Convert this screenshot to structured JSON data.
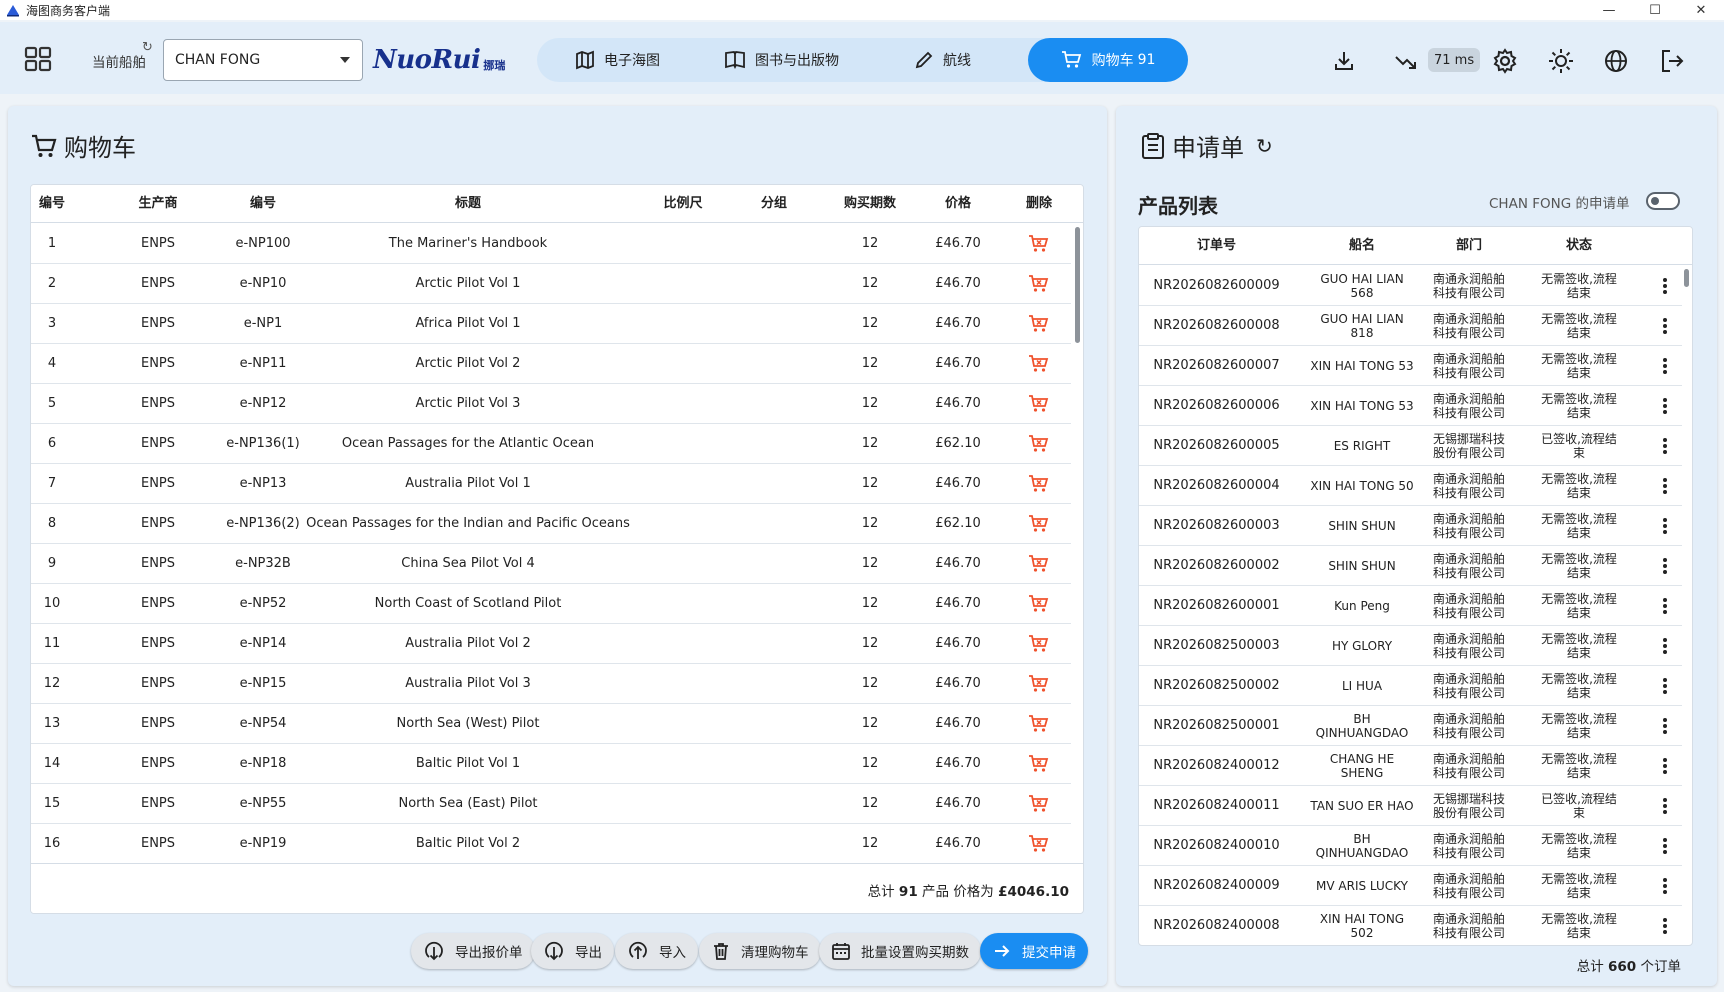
{
  "window": {
    "title": "海图商务客户端",
    "controls": [
      "—",
      "☐",
      "✕"
    ]
  },
  "toolbar": {
    "current_ship_label": "当前船舶",
    "ship": "CHAN FONG",
    "brand": "NuoRui",
    "brand_cn": "挪瑞",
    "tabs": [
      {
        "label": "电子海图",
        "icon": "map-icon"
      },
      {
        "label": "图书与出版物",
        "icon": "book-icon"
      },
      {
        "label": "航线",
        "icon": "pencil-icon"
      },
      {
        "label": "购物车",
        "count": "91",
        "icon": "cart-icon",
        "active": true
      }
    ],
    "latency": "71 ms",
    "accent_color": "#1a8df2"
  },
  "cart": {
    "title": "购物车",
    "columns": [
      "编号",
      "生产商",
      "编号",
      "标题",
      "比例尺",
      "分组",
      "购买期数",
      "价格",
      "删除"
    ],
    "rows": [
      [
        "1",
        "ENPS",
        "e-NP100",
        "The Mariner's Handbook",
        "",
        "",
        "12",
        "£46.70"
      ],
      [
        "2",
        "ENPS",
        "e-NP10",
        "Arctic Pilot Vol 1",
        "",
        "",
        "12",
        "£46.70"
      ],
      [
        "3",
        "ENPS",
        "e-NP1",
        "Africa Pilot Vol 1",
        "",
        "",
        "12",
        "£46.70"
      ],
      [
        "4",
        "ENPS",
        "e-NP11",
        "Arctic Pilot Vol 2",
        "",
        "",
        "12",
        "£46.70"
      ],
      [
        "5",
        "ENPS",
        "e-NP12",
        "Arctic Pilot Vol 3",
        "",
        "",
        "12",
        "£46.70"
      ],
      [
        "6",
        "ENPS",
        "e-NP136(1)",
        "Ocean Passages for the Atlantic Ocean",
        "",
        "",
        "12",
        "£62.10"
      ],
      [
        "7",
        "ENPS",
        "e-NP13",
        "Australia Pilot Vol 1",
        "",
        "",
        "12",
        "£46.70"
      ],
      [
        "8",
        "ENPS",
        "e-NP136(2)",
        "Ocean Passages for the Indian and Pacific Oceans",
        "",
        "",
        "12",
        "£62.10"
      ],
      [
        "9",
        "ENPS",
        "e-NP32B",
        "China Sea Pilot Vol 4",
        "",
        "",
        "12",
        "£46.70"
      ],
      [
        "10",
        "ENPS",
        "e-NP52",
        "North Coast of Scotland Pilot",
        "",
        "",
        "12",
        "£46.70"
      ],
      [
        "11",
        "ENPS",
        "e-NP14",
        "Australia Pilot Vol 2",
        "",
        "",
        "12",
        "£46.70"
      ],
      [
        "12",
        "ENPS",
        "e-NP15",
        "Australia Pilot Vol 3",
        "",
        "",
        "12",
        "£46.70"
      ],
      [
        "13",
        "ENPS",
        "e-NP54",
        "North Sea (West) Pilot",
        "",
        "",
        "12",
        "£46.70"
      ],
      [
        "14",
        "ENPS",
        "e-NP18",
        "Baltic Pilot Vol 1",
        "",
        "",
        "12",
        "£46.70"
      ],
      [
        "15",
        "ENPS",
        "e-NP55",
        "North Sea (East) Pilot",
        "",
        "",
        "12",
        "£46.70"
      ],
      [
        "16",
        "ENPS",
        "e-NP19",
        "Baltic Pilot Vol 2",
        "",
        "",
        "12",
        "£46.70"
      ]
    ],
    "footer": {
      "prefix": "总计",
      "count": "91",
      "mid": "产品 价格为",
      "total": "£4046.10"
    },
    "delete_icon_color": "#f0522c",
    "buttons": [
      {
        "label": "导出报价单",
        "icon": "download-circle-icon"
      },
      {
        "label": "导出",
        "icon": "download-circle-icon"
      },
      {
        "label": "导入",
        "icon": "upload-circle-icon"
      },
      {
        "label": "清理购物车",
        "icon": "trash-icon"
      },
      {
        "label": "批量设置购买期数",
        "icon": "calendar-icon"
      },
      {
        "label": "提交申请",
        "icon": "arrow-right-icon"
      }
    ]
  },
  "requests": {
    "title": "申请单",
    "subtitle": "产品列表",
    "toggle_label": "CHAN FONG 的申请单",
    "columns": [
      "订单号",
      "船名",
      "部门",
      "状态"
    ],
    "rows": [
      [
        "NR2026082600009",
        "GUO HAI LIAN 568",
        "南通永润船舶科技有限公司",
        "无需签收,流程结束"
      ],
      [
        "NR2026082600008",
        "GUO HAI LIAN 818",
        "南通永润船舶科技有限公司",
        "无需签收,流程结束"
      ],
      [
        "NR2026082600007",
        "XIN HAI TONG 53",
        "南通永润船舶科技有限公司",
        "无需签收,流程结束"
      ],
      [
        "NR2026082600006",
        "XIN HAI TONG 53",
        "南通永润船舶科技有限公司",
        "无需签收,流程结束"
      ],
      [
        "NR2026082600005",
        "ES RIGHT",
        "无锡挪瑞科技股份有限公司",
        "已签收,流程结束"
      ],
      [
        "NR2026082600004",
        "XIN HAI TONG 50",
        "南通永润船舶科技有限公司",
        "无需签收,流程结束"
      ],
      [
        "NR2026082600003",
        "SHIN SHUN",
        "南通永润船舶科技有限公司",
        "无需签收,流程结束"
      ],
      [
        "NR2026082600002",
        "SHIN SHUN",
        "南通永润船舶科技有限公司",
        "无需签收,流程结束"
      ],
      [
        "NR2026082600001",
        "Kun Peng",
        "南通永润船舶科技有限公司",
        "无需签收,流程结束"
      ],
      [
        "NR2026082500003",
        "HY GLORY",
        "南通永润船舶科技有限公司",
        "无需签收,流程结束"
      ],
      [
        "NR2026082500002",
        "LI HUA",
        "南通永润船舶科技有限公司",
        "无需签收,流程结束"
      ],
      [
        "NR2026082500001",
        "BH QINHUANGDAO",
        "南通永润船舶科技有限公司",
        "无需签收,流程结束"
      ],
      [
        "NR2026082400012",
        "CHANG HE SHENG",
        "南通永润船舶科技有限公司",
        "无需签收,流程结束"
      ],
      [
        "NR2026082400011",
        "TAN SUO ER HAO",
        "无锡挪瑞科技股份有限公司",
        "已签收,流程结束"
      ],
      [
        "NR2026082400010",
        "BH QINHUANGDAO",
        "南通永润船舶科技有限公司",
        "无需签收,流程结束"
      ],
      [
        "NR2026082400009",
        "MV ARIS LUCKY",
        "南通永润船舶科技有限公司",
        "无需签收,流程结束"
      ],
      [
        "NR2026082400008",
        "XIN HAI TONG 502",
        "南通永润船舶科技有限公司",
        "无需签收,流程结束"
      ]
    ],
    "total": {
      "prefix": "总计",
      "count": "660",
      "suffix": "个订单"
    }
  }
}
